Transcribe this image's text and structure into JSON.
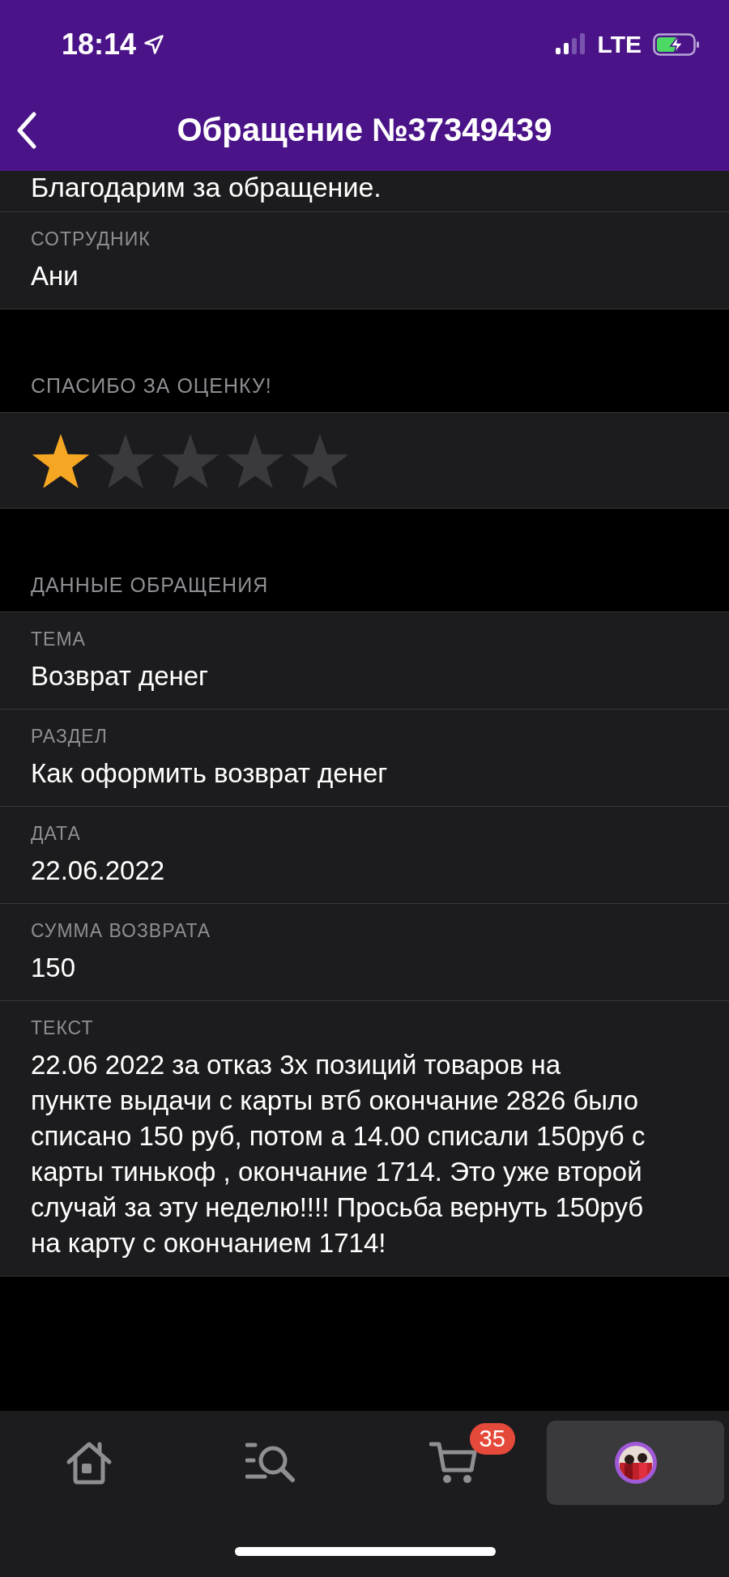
{
  "status_bar": {
    "time": "18:14",
    "network": "LTE"
  },
  "header": {
    "title": "Обращение №37349439"
  },
  "intro_text": "Благодарим за обращение.",
  "employee": {
    "label": "СОТРУДНИК",
    "value": "Ани"
  },
  "rating": {
    "heading": "СПАСИБО ЗА ОЦЕНКУ!",
    "stars": 1
  },
  "details": {
    "heading": "ДАННЫЕ ОБРАЩЕНИЯ",
    "fields": [
      {
        "label": "ТЕМА",
        "value": "Возврат денег"
      },
      {
        "label": "РАЗДЕЛ",
        "value": "Как оформить возврат денег"
      },
      {
        "label": "ДАТА",
        "value": "22.06.2022"
      },
      {
        "label": "СУММА ВОЗВРАТА",
        "value": "150"
      },
      {
        "label": "ТЕКСТ",
        "value": "22.06 2022 за отказ 3х позиций товаров на пункте выдачи с карты втб окончание 2826 было списано 150 руб,  потом а 14.00 списали 150руб с  карты тинькоф , окончание 1714. Это уже второй случай за эту неделю!!!! Просьба вернуть 150руб на карту с окончанием 1714!"
      }
    ]
  },
  "tab_bar": {
    "items": [
      {
        "kind": "home",
        "selected": false
      },
      {
        "kind": "search",
        "selected": false
      },
      {
        "kind": "cart",
        "selected": false,
        "badge": "35"
      },
      {
        "kind": "profile",
        "selected": true
      }
    ]
  }
}
